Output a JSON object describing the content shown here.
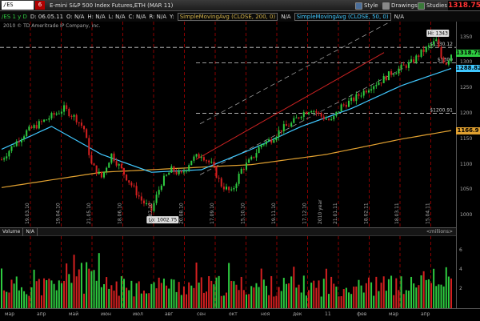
{
  "topbar": {
    "symbol": "/ES",
    "link_number": "6",
    "description": "E-mini S&P 500 Index Futures,ETH (MAR 11)",
    "style_label": "Style",
    "drawings_label": "Drawings",
    "studies_label": "Studies",
    "last_price": "1318.75"
  },
  "studybar": {
    "symbol_period": "/ES 1 y D",
    "date": "D: 06.05.11",
    "open": "O: N/A",
    "high": "H: N/A",
    "low": "L: N/A",
    "close": "C: N/A",
    "change": "R: N/A",
    "y_label": "Y:",
    "study1": "SimpleMovingAvg (CLOSE, 200, 0)",
    "study1_value": "N/A",
    "study2": "SimpleMovingAvg (CLOSE, 50, 0)",
    "study2_value": "N/A"
  },
  "copyright": "2010 © TD Ameritrade IP Company, Inc.",
  "annotations": {
    "high": "Hi: 1343",
    "low": "Lo: 1002.75",
    "line_1330": "$1330.12",
    "line_1300": "$1300",
    "line_1200": "$1200.91",
    "price_line_label": "2010 year"
  },
  "price_axis": {
    "ticks": [
      "1350",
      "1300",
      "1250",
      "1200",
      "1150",
      "1100",
      "1050",
      "1000"
    ],
    "badges": [
      {
        "text": "1318.75",
        "color": "#2ecc40"
      },
      {
        "text": "1288.82",
        "color": "#40c8ff"
      },
      {
        "text": "1166.9",
        "color": "#e0a030"
      }
    ]
  },
  "volume": {
    "title": "Volume",
    "value": "N/A",
    "units": "<millions>",
    "ticks": [
      "6",
      "4",
      "2"
    ]
  },
  "date_labels": [
    "19.03.10",
    "19.04.10",
    "21.05.10",
    "18.06.10",
    "16.07.10",
    "20.08.10",
    "17.09.10",
    "15.10.10",
    "19.11.10",
    "17.12.10",
    "21.01.11",
    "18.02.11",
    "18.03.11",
    "15.04.11"
  ],
  "month_labels": [
    "мар",
    "апр",
    "май",
    "июн",
    "июл",
    "авг",
    "сен",
    "окт",
    "ноя",
    "дек",
    "11",
    "фев",
    "мар",
    "апр"
  ],
  "chart_data": {
    "type": "candlestick",
    "title": "E-mini S&P 500 Index Futures,ETH (MAR 11)",
    "ylim": [
      980,
      1365
    ],
    "close_path": [
      [
        0,
        1110
      ],
      [
        5,
        1140
      ],
      [
        10,
        1165
      ],
      [
        15,
        1180
      ],
      [
        20,
        1195
      ],
      [
        25,
        1210
      ],
      [
        30,
        1190
      ],
      [
        33,
        1170
      ],
      [
        36,
        1100
      ],
      [
        40,
        1075
      ],
      [
        44,
        1120
      ],
      [
        48,
        1090
      ],
      [
        52,
        1060
      ],
      [
        56,
        1030
      ],
      [
        60,
        1010
      ],
      [
        64,
        1065
      ],
      [
        68,
        1090
      ],
      [
        72,
        1080
      ],
      [
        76,
        1110
      ],
      [
        80,
        1120
      ],
      [
        84,
        1100
      ],
      [
        88,
        1060
      ],
      [
        92,
        1045
      ],
      [
        96,
        1090
      ],
      [
        100,
        1110
      ],
      [
        104,
        1140
      ],
      [
        108,
        1150
      ],
      [
        112,
        1170
      ],
      [
        116,
        1180
      ],
      [
        120,
        1200
      ],
      [
        124,
        1210
      ],
      [
        128,
        1195
      ],
      [
        132,
        1185
      ],
      [
        136,
        1215
      ],
      [
        140,
        1225
      ],
      [
        144,
        1240
      ],
      [
        148,
        1255
      ],
      [
        152,
        1265
      ],
      [
        156,
        1280
      ],
      [
        160,
        1290
      ],
      [
        164,
        1300
      ],
      [
        168,
        1320
      ],
      [
        172,
        1335
      ],
      [
        174,
        1343
      ],
      [
        176,
        1310
      ],
      [
        178,
        1300
      ],
      [
        180,
        1318
      ]
    ],
    "sma200": [
      [
        0,
        1055
      ],
      [
        40,
        1085
      ],
      [
        80,
        1095
      ],
      [
        100,
        1100
      ],
      [
        130,
        1120
      ],
      [
        160,
        1150
      ],
      [
        180,
        1166.9
      ]
    ],
    "sma50": [
      [
        0,
        1130
      ],
      [
        20,
        1175
      ],
      [
        40,
        1120
      ],
      [
        60,
        1085
      ],
      [
        80,
        1090
      ],
      [
        100,
        1130
      ],
      [
        120,
        1175
      ],
      [
        140,
        1210
      ],
      [
        160,
        1255
      ],
      [
        180,
        1288.82
      ]
    ],
    "volume_max": 7,
    "hlines": [
      1330.12,
      1300,
      1200.91
    ]
  }
}
